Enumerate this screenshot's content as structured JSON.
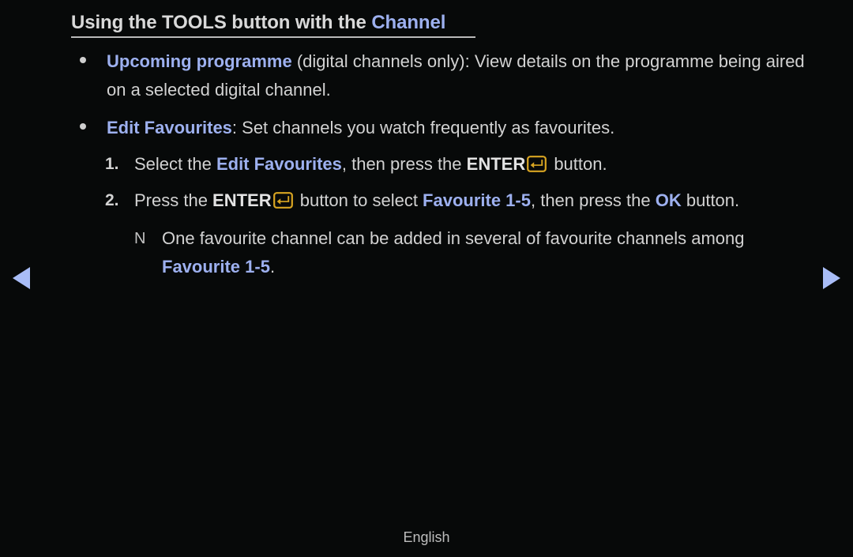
{
  "page": {
    "background_color": "#070909",
    "accent_blue": "#9db0ef",
    "key_icon_color": "#d9a522",
    "text_color": "#d2d2d2"
  },
  "title": {
    "lead": "Using the TOOLS button with the ",
    "highlight": "Channel"
  },
  "bullets": [
    {
      "marker": "bullet-dot",
      "segments": [
        {
          "text": "Upcoming programme",
          "style": "b-blue"
        },
        {
          "text": " (digital channels only): View details on the programme being aired on a selected digital channel.",
          "style": "plain"
        }
      ]
    },
    {
      "marker": "bullet-dot",
      "segments": [
        {
          "text": "Edit Favourites",
          "style": "b-blue"
        },
        {
          "text": ": Set channels you watch frequently as favourites.",
          "style": "plain"
        }
      ]
    }
  ],
  "steps": [
    {
      "number": "1.",
      "segments": [
        {
          "text": "Select the ",
          "style": "plain"
        },
        {
          "text": "Edit Favourites",
          "style": "b-blue"
        },
        {
          "text": ", then press the ",
          "style": "plain"
        },
        {
          "text": "ENTER",
          "style": "bold"
        },
        {
          "text": "enter-key-icon",
          "style": "icon"
        },
        {
          "text": " button.",
          "style": "plain"
        }
      ]
    },
    {
      "number": "2.",
      "segments": [
        {
          "text": "Press the ",
          "style": "plain"
        },
        {
          "text": "ENTER",
          "style": "bold"
        },
        {
          "text": "enter-key-icon",
          "style": "icon"
        },
        {
          "text": " button to select ",
          "style": "plain"
        },
        {
          "text": "Favourite 1-5",
          "style": "b-blue"
        },
        {
          "text": ", then press the ",
          "style": "plain"
        },
        {
          "text": "OK",
          "style": "b-blue"
        },
        {
          "text": " button.",
          "style": "plain"
        }
      ]
    }
  ],
  "note": {
    "marker": "N",
    "segments": [
      {
        "text": "One favourite channel can be added in several of favourite channels among ",
        "style": "plain"
      },
      {
        "text": "Favourite 1-5",
        "style": "b-blue"
      },
      {
        "text": ".",
        "style": "plain"
      }
    ]
  },
  "nav": {
    "previous_label": "previous-page-arrow",
    "next_label": "next-page-arrow"
  },
  "footer": {
    "language": "English"
  }
}
